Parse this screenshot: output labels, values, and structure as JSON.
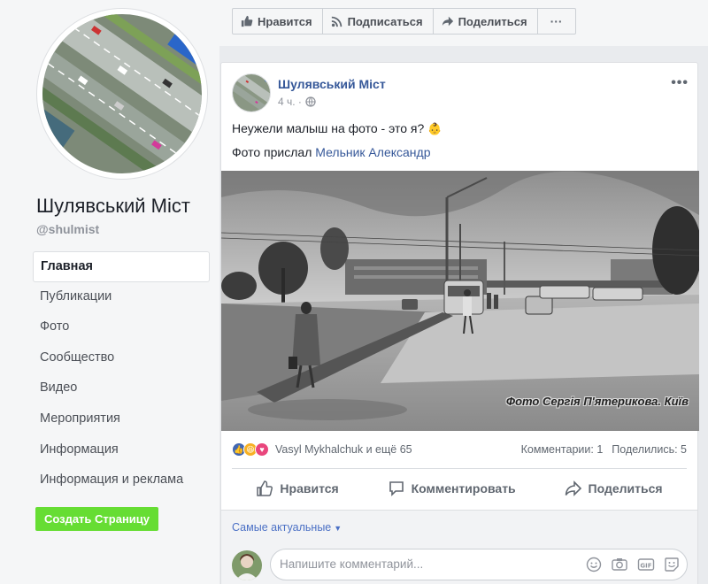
{
  "sidebar": {
    "page_name": "Шулявський Міст",
    "handle": "@shulmist",
    "nav": [
      {
        "label": "Главная"
      },
      {
        "label": "Публикации"
      },
      {
        "label": "Фото"
      },
      {
        "label": "Сообщество"
      },
      {
        "label": "Видео"
      },
      {
        "label": "Мероприятия"
      },
      {
        "label": "Информация"
      },
      {
        "label": "Информация и реклама"
      }
    ],
    "create_page_label": "Создать Страницу"
  },
  "topbar": {
    "like_label": "Нравится",
    "subscribe_label": "Подписаться",
    "share_label": "Поделиться",
    "more_label": "···"
  },
  "post": {
    "author": "Шулявський Міст",
    "time": "4 ч. ·",
    "more_label": "•••",
    "text": "Неужели малыш на фото - это я?",
    "emoji": "👶",
    "credit_prefix": "Фото прислал",
    "credit_name": "Мельник Александр",
    "watermark": "Фото Сергія П'ятерикова. Київ",
    "reactions_text": "Vasyl Mykhalchuk и ещё 65",
    "comments_count": "Комментарии: 1",
    "shares_count": "Поделились: 5",
    "action_like": "Нравится",
    "action_comment": "Комментировать",
    "action_share": "Поделиться",
    "sort_label": "Самые актуальные",
    "comment_placeholder": "Напишите комментарий..."
  },
  "colors": {
    "link": "#365899",
    "create_button": "#66dd33",
    "like_reaction": "#4267b2",
    "haha_reaction": "#f7b125",
    "love_reaction": "#e9467d"
  }
}
